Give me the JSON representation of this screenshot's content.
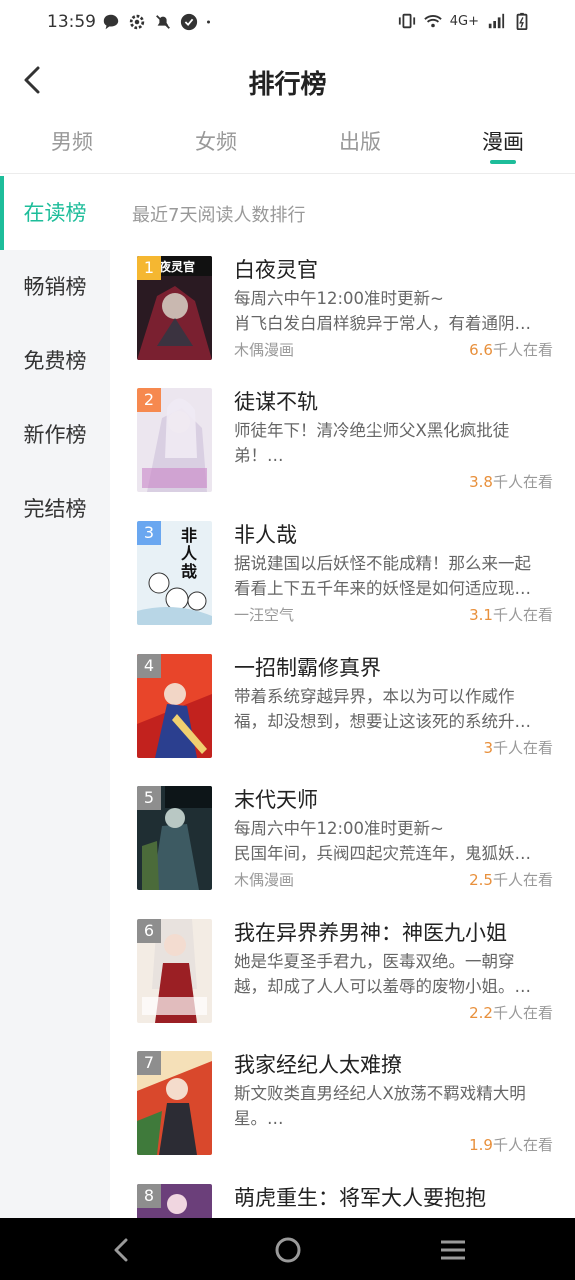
{
  "status_bar": {
    "time": "13:59",
    "network_label": "4G+",
    "left_icons": [
      "chat-bubble-icon",
      "gear-icon",
      "mute-icon",
      "check-circle-icon",
      "dot-icon"
    ],
    "right_icons": [
      "vibrate-icon",
      "wifi-icon",
      "signal-icon",
      "battery-icon"
    ]
  },
  "header": {
    "title": "排行榜",
    "back_icon": "chevron-left-icon"
  },
  "tabs": [
    {
      "label": "男频",
      "active": false
    },
    {
      "label": "女频",
      "active": false
    },
    {
      "label": "出版",
      "active": false
    },
    {
      "label": "漫画",
      "active": true
    }
  ],
  "accent_color": "#1dbd9a",
  "readers_color": "#e8903c",
  "sidebar": {
    "items": [
      {
        "label": "在读榜",
        "active": true
      },
      {
        "label": "畅销榜",
        "active": false
      },
      {
        "label": "免费榜",
        "active": false
      },
      {
        "label": "新作榜",
        "active": false
      },
      {
        "label": "完结榜",
        "active": false
      }
    ]
  },
  "list": {
    "description": "最近7天阅读人数排行",
    "items": [
      {
        "rank": "1",
        "rank_color": "#f5b731",
        "title": "白夜灵官",
        "desc_lines": [
          "每周六中午12:00准时更新~",
          "肖飞白发白眉样貌异于常人，有着通阴…"
        ],
        "author": "木偶漫画",
        "readers_num": "6.6",
        "readers_suffix": "千人在看"
      },
      {
        "rank": "2",
        "rank_color": "#f6894f",
        "title": "徒谋不轨",
        "desc_lines": [
          "师徒年下！清冷绝尘师父X黑化疯批徒",
          "弟！…"
        ],
        "author": "",
        "readers_num": "3.8",
        "readers_suffix": "千人在看"
      },
      {
        "rank": "3",
        "rank_color": "#6aa7f0",
        "title": "非人哉",
        "desc_lines": [
          "据说建国以后妖怪不能成精！那么来一起",
          "看看上下五千年来的妖怪是如何适应现…"
        ],
        "author": "一汪空气",
        "readers_num": "3.1",
        "readers_suffix": "千人在看"
      },
      {
        "rank": "4",
        "rank_color": "#8e8e8e",
        "title": "一招制霸修真界",
        "desc_lines": [
          "带着系统穿越异界，本以为可以作威作",
          "福，却没想到，想要让这该死的系统升…"
        ],
        "author": "",
        "readers_num": "3",
        "readers_suffix": "千人在看"
      },
      {
        "rank": "5",
        "rank_color": "#8e8e8e",
        "title": "末代天师",
        "desc_lines": [
          "每周六中午12:00准时更新~",
          "民国年间，兵阀四起灾荒连年，鬼狐妖…"
        ],
        "author": "木偶漫画",
        "readers_num": "2.5",
        "readers_suffix": "千人在看"
      },
      {
        "rank": "6",
        "rank_color": "#8e8e8e",
        "title": "我在异界养男神：神医九小姐",
        "desc_lines": [
          "她是华夏圣手君九，医毒双绝。一朝穿",
          "越，却成了人人可以羞辱的废物小姐。…"
        ],
        "author": "",
        "readers_num": "2.2",
        "readers_suffix": "千人在看"
      },
      {
        "rank": "7",
        "rank_color": "#8e8e8e",
        "title": "我家经纪人太难撩",
        "desc_lines": [
          "斯文败类直男经纪人X放荡不羁戏精大明",
          "星。…"
        ],
        "author": "",
        "readers_num": "1.9",
        "readers_suffix": "千人在看"
      },
      {
        "rank": "8",
        "rank_color": "#8e8e8e",
        "title": "萌虎重生：将军大人要抱抱",
        "desc_lines": [
          "",
          ""
        ],
        "author": "",
        "readers_num": "",
        "readers_suffix": ""
      }
    ]
  },
  "nav_bar": {
    "icons": [
      "back-triangle-icon",
      "home-circle-icon",
      "menu-lines-icon"
    ]
  }
}
